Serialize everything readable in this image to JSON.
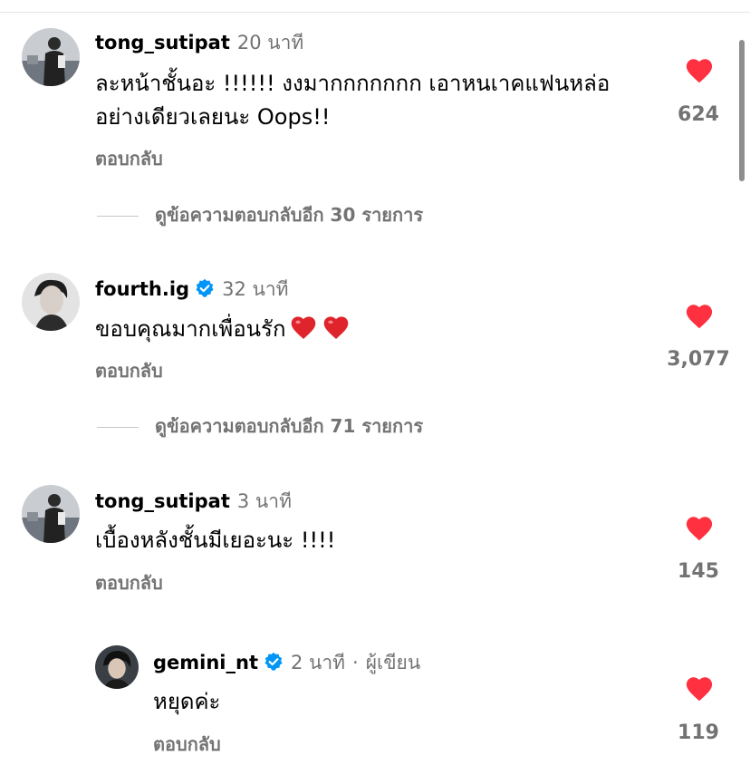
{
  "comments": [
    {
      "username": "tong_sutipat",
      "time": "20 นาที",
      "text_line1": "ละหน้าชั้นอะ !!!!!! งงมากกกกกกก เอาหนเาคแฟนหล่อ",
      "text_line2": "อย่างเดียวเลยนะ Oops!!",
      "reply_label": "ตอบกลับ",
      "likes": "624",
      "view_replies": "ดูข้อความตอบกลับอีก 30 รายการ"
    },
    {
      "username": "fourth.ig",
      "time": "32 นาที",
      "text": "ขอบคุณมากเพื่อนรัก",
      "reply_label": "ตอบกลับ",
      "likes": "3,077",
      "view_replies": "ดูข้อความตอบกลับอีก 71 รายการ"
    },
    {
      "username": "tong_sutipat",
      "time": "3 นาที",
      "text": "เบื้องหลังชั้นมีเยอะนะ !!!!",
      "reply_label": "ตอบกลับ",
      "likes": "145"
    },
    {
      "username": "gemini_nt",
      "time": "2 นาที",
      "separator": "·",
      "author_tag": "ผู้เขียน",
      "text": "หยุดค่ะ",
      "reply_label": "ตอบกลับ",
      "likes": "119"
    }
  ],
  "colors": {
    "heart": "#ff3040",
    "verified": "#0095f6",
    "secondary_text": "#737373"
  },
  "icons": {
    "like": "heart-icon",
    "verified": "verified-badge-icon",
    "emoji": "red-heart-emoji"
  }
}
